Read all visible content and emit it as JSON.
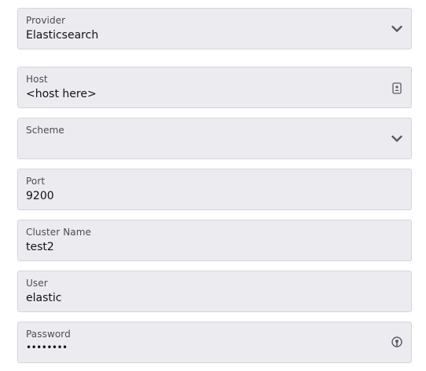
{
  "form": {
    "provider": {
      "label": "Provider",
      "value": "Elasticsearch",
      "icon": "chevron-down-icon"
    },
    "host": {
      "label": "Host",
      "value": "<host here>",
      "icon": "contact-card-icon"
    },
    "scheme": {
      "label": "Scheme",
      "value": "",
      "icon": "chevron-down-icon"
    },
    "port": {
      "label": "Port",
      "value": "9200"
    },
    "cluster_name": {
      "label": "Cluster Name",
      "value": "test2"
    },
    "user": {
      "label": "User",
      "value": "elastic"
    },
    "password": {
      "label": "Password",
      "value": "••••••••",
      "icon": "password-key-icon"
    }
  },
  "colors": {
    "field_bg": "#ececf0",
    "field_border": "#d4d5dc",
    "label": "#4a4b55",
    "value": "#101218",
    "icon": "#5a5b66"
  }
}
